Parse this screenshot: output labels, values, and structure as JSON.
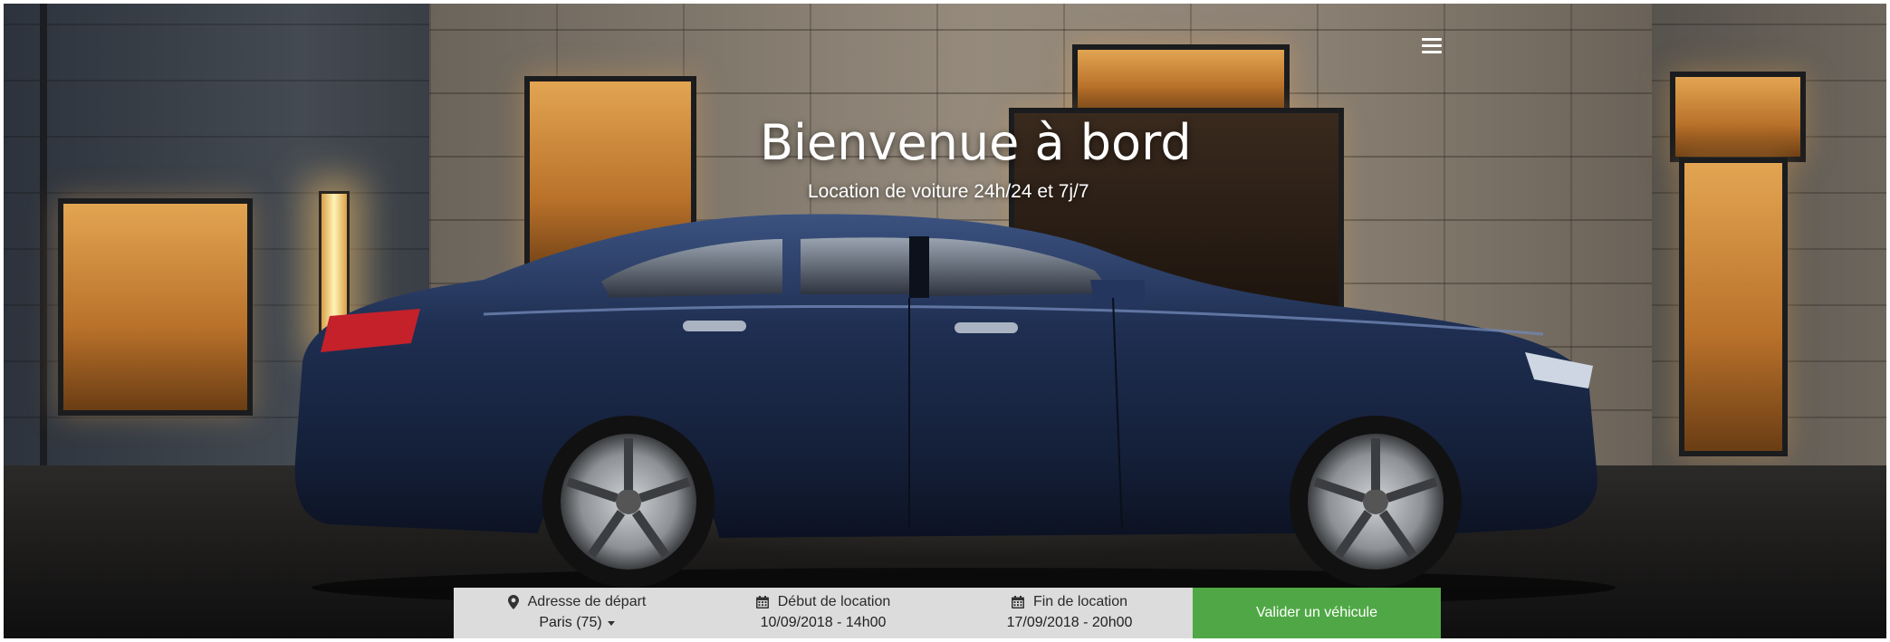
{
  "header": {
    "menu_icon": "hamburger-menu-icon"
  },
  "hero": {
    "title": "Bienvenue à bord",
    "subtitle": "Location de voiture 24h/24 et 7j/7"
  },
  "booking": {
    "departure": {
      "icon": "map-pin-icon",
      "label": "Adresse de départ",
      "value": "Paris (75)"
    },
    "start": {
      "icon": "calendar-icon",
      "label": "Début de location",
      "value": "10/09/2018 - 14h00"
    },
    "end": {
      "icon": "calendar-icon",
      "label": "Fin de location",
      "value": "17/09/2018 - 20h00"
    },
    "submit_label": "Valider un véhicule"
  },
  "colors": {
    "submit_green": "#4fa845",
    "bar_gray": "#dcdcdc",
    "car_blue": "#1c2a4a"
  }
}
